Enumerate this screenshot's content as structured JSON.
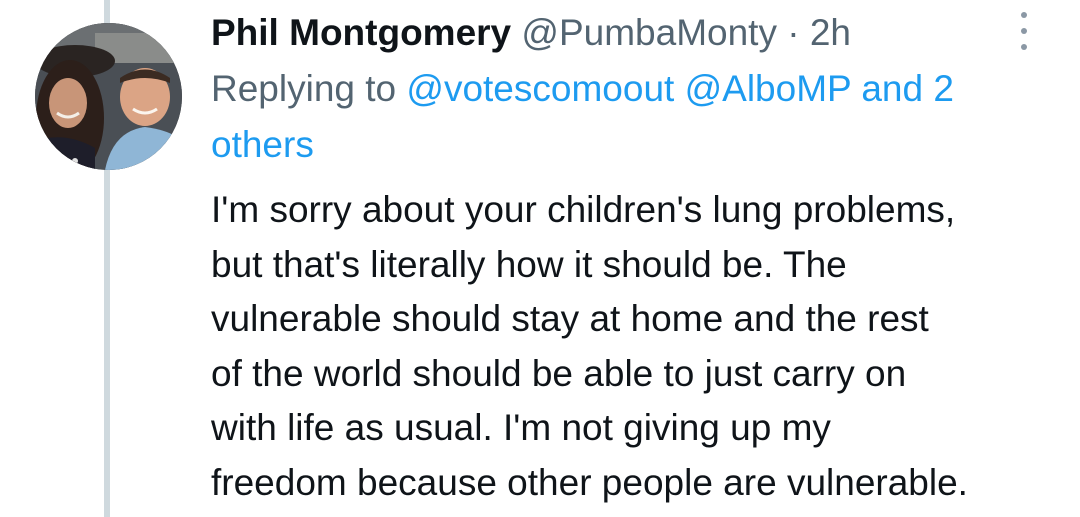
{
  "tweet": {
    "author": {
      "display_name": "Phil Montgomery",
      "handle": "@PumbaMonty",
      "separator": " · ",
      "time": "2h",
      "avatar_icon": "profile-photo-avatar"
    },
    "reply": {
      "prefix": "Replying to ",
      "mention_1": "@votescomoout",
      "mention_2": "@AlboMP",
      "conjunction": " and 2",
      "others": "others"
    },
    "text_lines": [
      "I'm sorry about your children's lung problems,",
      "but that's literally how it should be. The",
      "vulnerable should stay at home and the rest",
      "of the world should be able to just carry on",
      "with life as usual. I'm not giving up my",
      "freedom because other people are vulnerable."
    ],
    "more_icon": "more-vertical-icon"
  },
  "colors": {
    "text_primary": "#0f1419",
    "text_secondary": "#536471",
    "link": "#1d9bf0",
    "thread_line": "#cfd9de"
  }
}
